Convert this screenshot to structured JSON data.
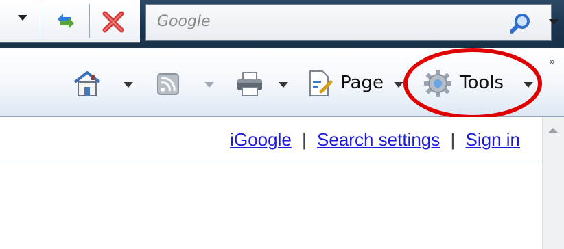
{
  "addressbar": {
    "search_placeholder": "Google"
  },
  "commandbar": {
    "overflow_label": "»",
    "page_label": "Page",
    "tools_label": "Tools"
  },
  "content": {
    "links": [
      {
        "label": "iGoogle"
      },
      {
        "label": "Search settings"
      },
      {
        "label": "Sign in"
      }
    ],
    "separator": "|"
  },
  "annotation": {
    "highlight_color": "#e10000",
    "highlighted_item": "tools"
  },
  "icons": {
    "refresh": "refresh-icon",
    "stop": "stop-icon",
    "search": "search-icon",
    "home": "home-icon",
    "feeds": "rss-icon",
    "print": "print-icon",
    "page": "page-icon",
    "tools": "gear-icon"
  }
}
